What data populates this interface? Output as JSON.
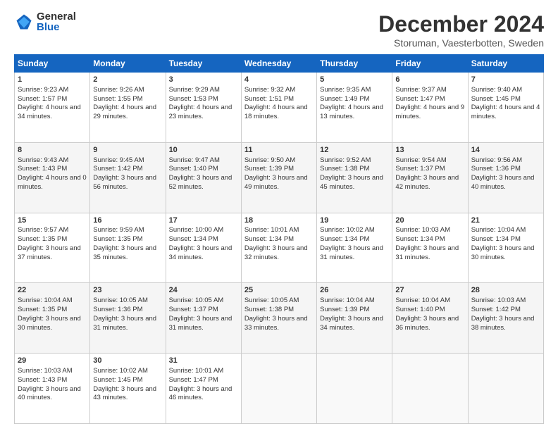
{
  "logo": {
    "general": "General",
    "blue": "Blue"
  },
  "title": {
    "month_year": "December 2024",
    "location": "Storuman, Vaesterbotten, Sweden"
  },
  "weekdays": [
    "Sunday",
    "Monday",
    "Tuesday",
    "Wednesday",
    "Thursday",
    "Friday",
    "Saturday"
  ],
  "weeks": [
    [
      {
        "day": "1",
        "sunrise": "9:23 AM",
        "sunset": "1:57 PM",
        "daylight": "4 hours and 34 minutes."
      },
      {
        "day": "2",
        "sunrise": "9:26 AM",
        "sunset": "1:55 PM",
        "daylight": "4 hours and 29 minutes."
      },
      {
        "day": "3",
        "sunrise": "9:29 AM",
        "sunset": "1:53 PM",
        "daylight": "4 hours and 23 minutes."
      },
      {
        "day": "4",
        "sunrise": "9:32 AM",
        "sunset": "1:51 PM",
        "daylight": "4 hours and 18 minutes."
      },
      {
        "day": "5",
        "sunrise": "9:35 AM",
        "sunset": "1:49 PM",
        "daylight": "4 hours and 13 minutes."
      },
      {
        "day": "6",
        "sunrise": "9:37 AM",
        "sunset": "1:47 PM",
        "daylight": "4 hours and 9 minutes."
      },
      {
        "day": "7",
        "sunrise": "9:40 AM",
        "sunset": "1:45 PM",
        "daylight": "4 hours and 4 minutes."
      }
    ],
    [
      {
        "day": "8",
        "sunrise": "9:43 AM",
        "sunset": "1:43 PM",
        "daylight": "4 hours and 0 minutes."
      },
      {
        "day": "9",
        "sunrise": "9:45 AM",
        "sunset": "1:42 PM",
        "daylight": "3 hours and 56 minutes."
      },
      {
        "day": "10",
        "sunrise": "9:47 AM",
        "sunset": "1:40 PM",
        "daylight": "3 hours and 52 minutes."
      },
      {
        "day": "11",
        "sunrise": "9:50 AM",
        "sunset": "1:39 PM",
        "daylight": "3 hours and 49 minutes."
      },
      {
        "day": "12",
        "sunrise": "9:52 AM",
        "sunset": "1:38 PM",
        "daylight": "3 hours and 45 minutes."
      },
      {
        "day": "13",
        "sunrise": "9:54 AM",
        "sunset": "1:37 PM",
        "daylight": "3 hours and 42 minutes."
      },
      {
        "day": "14",
        "sunrise": "9:56 AM",
        "sunset": "1:36 PM",
        "daylight": "3 hours and 40 minutes."
      }
    ],
    [
      {
        "day": "15",
        "sunrise": "9:57 AM",
        "sunset": "1:35 PM",
        "daylight": "3 hours and 37 minutes."
      },
      {
        "day": "16",
        "sunrise": "9:59 AM",
        "sunset": "1:35 PM",
        "daylight": "3 hours and 35 minutes."
      },
      {
        "day": "17",
        "sunrise": "10:00 AM",
        "sunset": "1:34 PM",
        "daylight": "3 hours and 34 minutes."
      },
      {
        "day": "18",
        "sunrise": "10:01 AM",
        "sunset": "1:34 PM",
        "daylight": "3 hours and 32 minutes."
      },
      {
        "day": "19",
        "sunrise": "10:02 AM",
        "sunset": "1:34 PM",
        "daylight": "3 hours and 31 minutes."
      },
      {
        "day": "20",
        "sunrise": "10:03 AM",
        "sunset": "1:34 PM",
        "daylight": "3 hours and 31 minutes."
      },
      {
        "day": "21",
        "sunrise": "10:04 AM",
        "sunset": "1:34 PM",
        "daylight": "3 hours and 30 minutes."
      }
    ],
    [
      {
        "day": "22",
        "sunrise": "10:04 AM",
        "sunset": "1:35 PM",
        "daylight": "3 hours and 30 minutes."
      },
      {
        "day": "23",
        "sunrise": "10:05 AM",
        "sunset": "1:36 PM",
        "daylight": "3 hours and 31 minutes."
      },
      {
        "day": "24",
        "sunrise": "10:05 AM",
        "sunset": "1:37 PM",
        "daylight": "3 hours and 31 minutes."
      },
      {
        "day": "25",
        "sunrise": "10:05 AM",
        "sunset": "1:38 PM",
        "daylight": "3 hours and 33 minutes."
      },
      {
        "day": "26",
        "sunrise": "10:04 AM",
        "sunset": "1:39 PM",
        "daylight": "3 hours and 34 minutes."
      },
      {
        "day": "27",
        "sunrise": "10:04 AM",
        "sunset": "1:40 PM",
        "daylight": "3 hours and 36 minutes."
      },
      {
        "day": "28",
        "sunrise": "10:03 AM",
        "sunset": "1:42 PM",
        "daylight": "3 hours and 38 minutes."
      }
    ],
    [
      {
        "day": "29",
        "sunrise": "10:03 AM",
        "sunset": "1:43 PM",
        "daylight": "3 hours and 40 minutes."
      },
      {
        "day": "30",
        "sunrise": "10:02 AM",
        "sunset": "1:45 PM",
        "daylight": "3 hours and 43 minutes."
      },
      {
        "day": "31",
        "sunrise": "10:01 AM",
        "sunset": "1:47 PM",
        "daylight": "3 hours and 46 minutes."
      },
      null,
      null,
      null,
      null
    ]
  ]
}
